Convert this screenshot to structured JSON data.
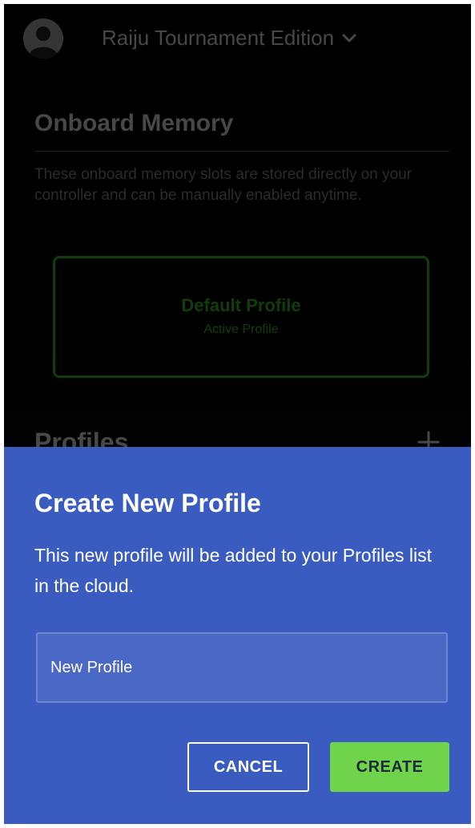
{
  "header": {
    "device_name": "Raiju Tournament Edition"
  },
  "onboard": {
    "title": "Onboard Memory",
    "description": "These onboard memory slots are stored directly on your controller and can be manually enabled anytime.",
    "profile": {
      "name": "Default Profile",
      "status": "Active Profile"
    }
  },
  "profiles": {
    "title": "Profiles"
  },
  "dialog": {
    "title": "Create New Profile",
    "description": "This new profile will be added to your Profiles list in the cloud.",
    "input_value": "New Profile",
    "cancel_label": "CANCEL",
    "create_label": "CREATE"
  },
  "colors": {
    "accent_green": "#44d62c",
    "sheet_blue": "#3a5bbf",
    "create_button": "#6fd44c"
  },
  "icons": {
    "avatar": "user-avatar-icon",
    "device_dropdown": "chevron-down-icon",
    "add_profile": "plus-icon"
  }
}
